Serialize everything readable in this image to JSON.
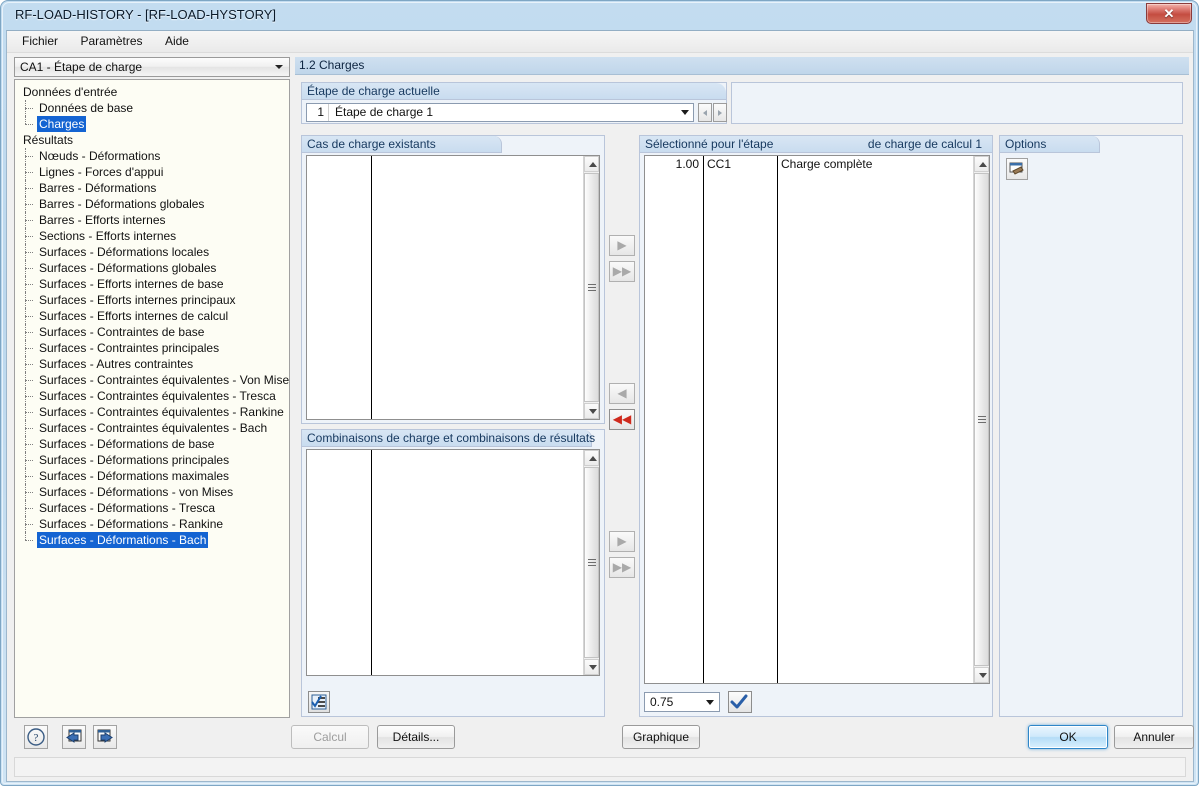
{
  "window": {
    "title": "RF-LOAD-HISTORY - [RF-LOAD-HYSTORY]",
    "close_label": "✕"
  },
  "menubar": {
    "items": [
      {
        "label": "Fichier"
      },
      {
        "label": "Paramètres"
      },
      {
        "label": "Aide"
      }
    ]
  },
  "sidebar": {
    "combo_value": "CA1 - Étape de charge",
    "tree": [
      {
        "label": "Données d'entrée",
        "level": 0,
        "selected": false
      },
      {
        "label": "Données de base",
        "level": 1,
        "selected": false
      },
      {
        "label": "Charges",
        "level": 1,
        "selected": true,
        "last": true
      },
      {
        "label": "Résultats",
        "level": 0,
        "selected": false
      },
      {
        "label": "Nœuds - Déformations",
        "level": 1,
        "selected": false
      },
      {
        "label": "Lignes - Forces d'appui",
        "level": 1,
        "selected": false
      },
      {
        "label": "Barres - Déformations",
        "level": 1,
        "selected": false
      },
      {
        "label": "Barres - Déformations globales",
        "level": 1,
        "selected": false
      },
      {
        "label": "Barres - Efforts internes",
        "level": 1,
        "selected": false
      },
      {
        "label": "Sections - Efforts internes",
        "level": 1,
        "selected": false
      },
      {
        "label": "Surfaces - Déformations locales",
        "level": 1,
        "selected": false
      },
      {
        "label": "Surfaces - Déformations globales",
        "level": 1,
        "selected": false
      },
      {
        "label": "Surfaces - Efforts internes de base",
        "level": 1,
        "selected": false
      },
      {
        "label": "Surfaces - Efforts internes principaux",
        "level": 1,
        "selected": false
      },
      {
        "label": "Surfaces - Efforts internes de calcul",
        "level": 1,
        "selected": false
      },
      {
        "label": "Surfaces - Contraintes de base",
        "level": 1,
        "selected": false
      },
      {
        "label": "Surfaces - Contraintes principales",
        "level": 1,
        "selected": false
      },
      {
        "label": "Surfaces - Autres contraintes",
        "level": 1,
        "selected": false
      },
      {
        "label": "Surfaces - Contraintes équivalentes - Von Mises",
        "level": 1,
        "selected": false
      },
      {
        "label": "Surfaces - Contraintes équivalentes - Tresca",
        "level": 1,
        "selected": false
      },
      {
        "label": "Surfaces - Contraintes équivalentes - Rankine",
        "level": 1,
        "selected": false
      },
      {
        "label": "Surfaces - Contraintes équivalentes - Bach",
        "level": 1,
        "selected": false
      },
      {
        "label": "Surfaces - Déformations de base",
        "level": 1,
        "selected": false
      },
      {
        "label": "Surfaces - Déformations principales",
        "level": 1,
        "selected": false
      },
      {
        "label": "Surfaces - Déformations maximales",
        "level": 1,
        "selected": false
      },
      {
        "label": "Surfaces - Déformations - von Mises",
        "level": 1,
        "selected": false
      },
      {
        "label": "Surfaces - Déformations - Tresca",
        "level": 1,
        "selected": false
      },
      {
        "label": "Surfaces - Déformations - Rankine",
        "level": 1,
        "selected": false
      },
      {
        "label": "Surfaces - Déformations - Bach",
        "level": 1,
        "selected": true,
        "last": true
      }
    ]
  },
  "main": {
    "section_title": "1.2 Charges",
    "current_step": {
      "caption": "Étape de charge actuelle",
      "number": "1",
      "name": "Étape de charge 1"
    },
    "existing_cases": {
      "caption": "Cas de charge existants",
      "rows": []
    },
    "combinations": {
      "caption": "Combinaisons de charge et combinaisons de résultats",
      "rows": []
    },
    "selected_for_step": {
      "caption_left": "Sélectionné pour l'étape",
      "caption_right": "de charge de calcul 1",
      "columns": [
        "factor",
        "case",
        "description"
      ],
      "rows": [
        {
          "factor": "1.00",
          "case": "CC1",
          "description": "Charge complète"
        }
      ],
      "value_combo": "0.75"
    },
    "options": {
      "caption": "Options"
    },
    "transfer": {
      "move_right": "▶",
      "move_all_right": "▶▶",
      "move_left": "◀",
      "move_all_left": "◀◀"
    }
  },
  "footer": {
    "calcul_label": "Calcul",
    "details_label": "Détails...",
    "graphique_label": "Graphique",
    "ok_label": "OK",
    "annuler_label": "Annuler"
  }
}
